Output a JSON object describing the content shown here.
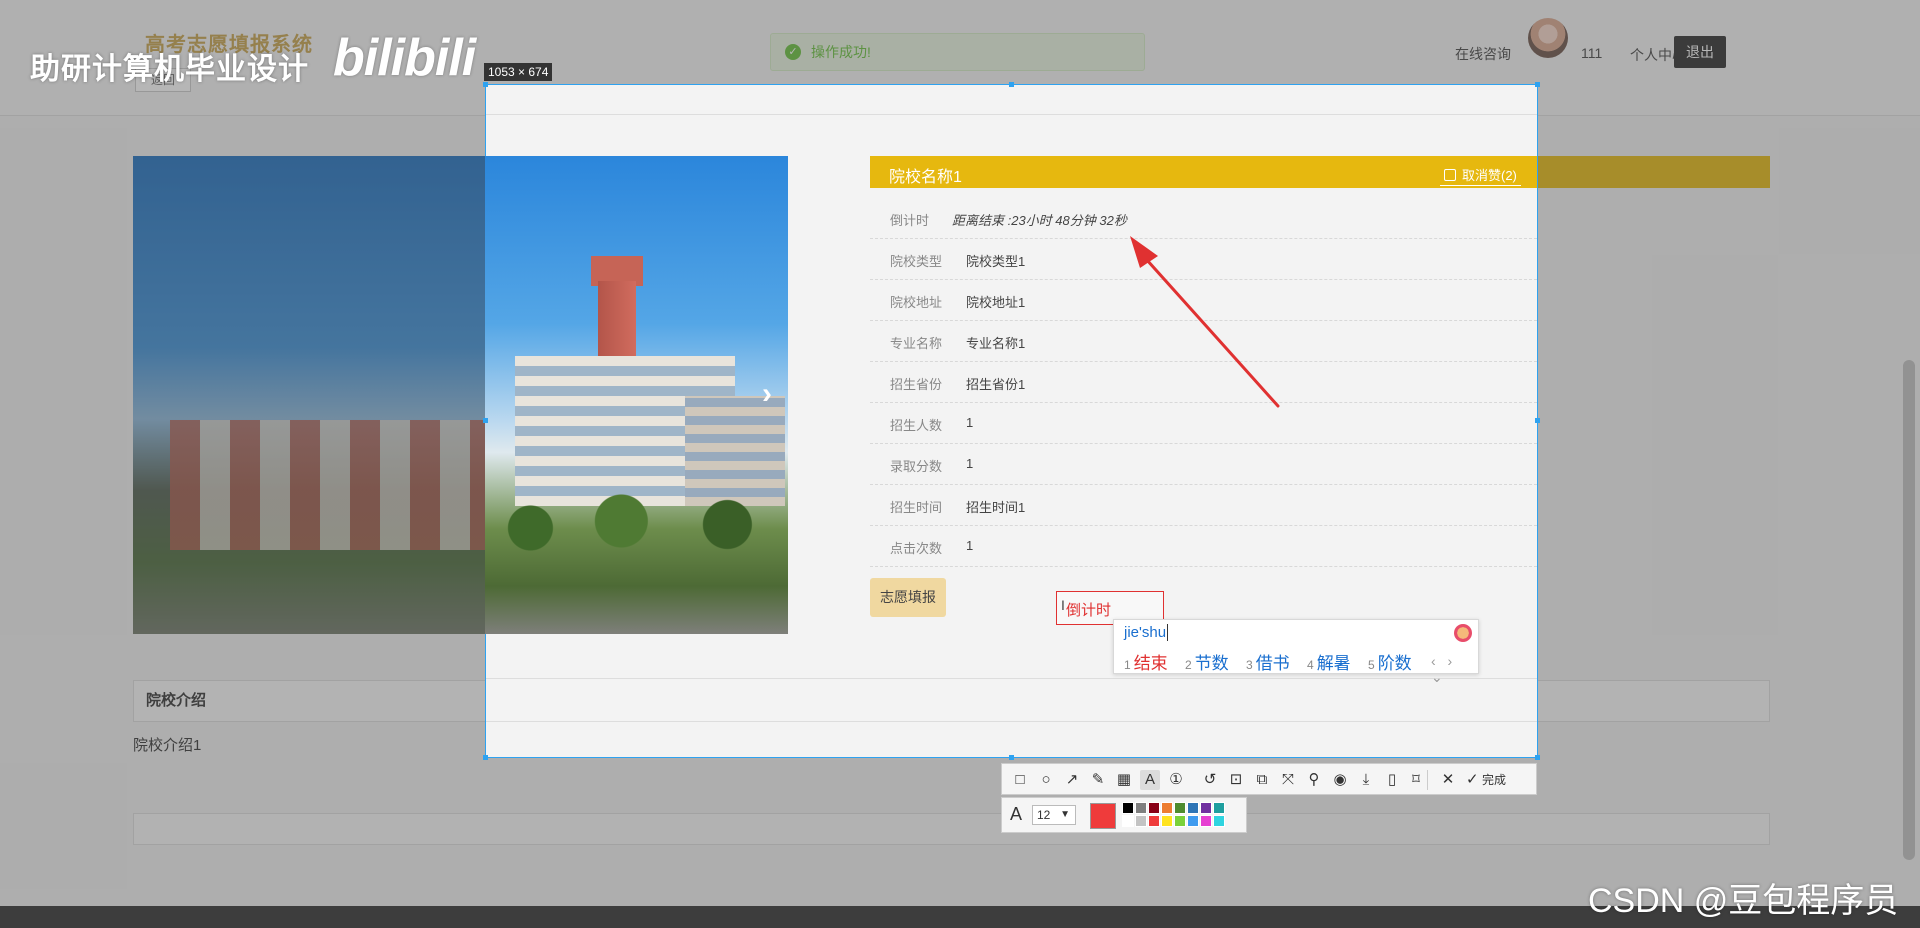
{
  "background": {
    "system_title": "高考志愿填报系统",
    "back_label": "返回",
    "toast": "操作成功!",
    "nav": {
      "consult": "在线咨询",
      "username": "111",
      "center": "个人中心",
      "logout": "退出"
    },
    "intro_title": "院校介绍",
    "intro_text": "院校介绍1"
  },
  "watermark": {
    "text": "助研计算机毕业设计",
    "logo": "bilibili",
    "csdn": "CSDN @豆包程序员"
  },
  "selection": {
    "size_label": "1053 × 674"
  },
  "detail": {
    "school_name": "院校名称1",
    "like_label": "取消赞(2)",
    "next_arrow": "›",
    "rows": [
      {
        "label": "倒计时",
        "value": "距离结束 :23小时 48分钟 32秒"
      },
      {
        "label": "院校类型",
        "value": "院校类型1"
      },
      {
        "label": "院校地址",
        "value": "院校地址1"
      },
      {
        "label": "专业名称",
        "value": "专业名称1"
      },
      {
        "label": "招生省份",
        "value": "招生省份1"
      },
      {
        "label": "招生人数",
        "value": "1"
      },
      {
        "label": "录取分数",
        "value": "1"
      },
      {
        "label": "招生时间",
        "value": "招生时间1"
      },
      {
        "label": "点击次数",
        "value": "1"
      }
    ],
    "apply_button": "志愿填报"
  },
  "annotation": {
    "text": "倒计时"
  },
  "ime": {
    "input": "jie'shu",
    "candidates": [
      {
        "num": "1",
        "word": "结束"
      },
      {
        "num": "2",
        "word": "节数"
      },
      {
        "num": "3",
        "word": "借书"
      },
      {
        "num": "4",
        "word": "解暑"
      },
      {
        "num": "5",
        "word": "阶数"
      }
    ],
    "nav": "‹ › ⌄"
  },
  "toolbar": {
    "tools": [
      "rectangle-icon",
      "ellipse-icon",
      "arrow-icon",
      "pencil-icon",
      "mosaic-icon",
      "text-icon",
      "number-icon",
      "undo-icon",
      "ocr-icon",
      "translate-icon",
      "long-screenshot-icon",
      "pin-icon",
      "record-icon",
      "download-icon",
      "mobile-icon",
      "bookmark-icon",
      "close-icon"
    ],
    "done_label": "完成",
    "font_size": "12",
    "current_color": "#ef3b3b",
    "palette": [
      "#000000",
      "#7f7f7f",
      "#880015",
      "#ed7d31",
      "#4e8c2f",
      "#2e75b6",
      "#7030a0",
      "#1f9f9f",
      "#ffffff",
      "#c3c3c3",
      "#ef3b3b",
      "#ffe31f",
      "#7ad13a",
      "#3f9bef",
      "#e63fd2",
      "#2fd4e0"
    ]
  },
  "colors": {
    "accent_yellow": "#e6b80f",
    "selection_blue": "#2ea2f0",
    "annotation_red": "#e03131"
  }
}
